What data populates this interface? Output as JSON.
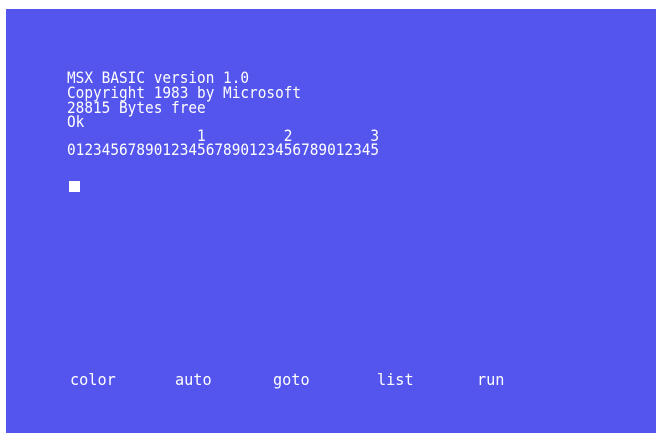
{
  "screen": {
    "background_color": "#5455ed",
    "text_color": "#ffffff",
    "lines": [
      "MSX BASIC version 1.0",
      "Copyright 1983 by Microsoft",
      "28815 Bytes free",
      "Ok",
      "               1         2         3",
      "012345678901234567890123456789012345"
    ]
  },
  "function_keys": [
    "color",
    "auto",
    "goto",
    "list",
    "run"
  ]
}
